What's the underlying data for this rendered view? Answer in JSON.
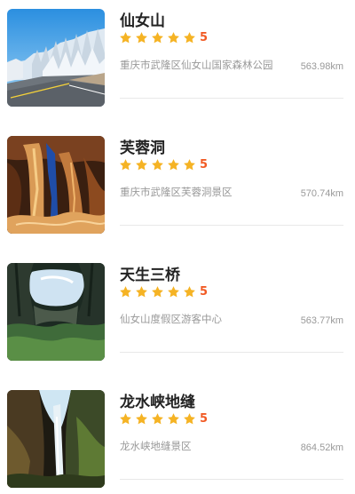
{
  "attractions": [
    {
      "name": "仙女山",
      "rating": 5,
      "rating_text": "5",
      "address": "重庆市武隆区仙女山国家森林公园",
      "distance": "563.98km",
      "thumbnail": "snowy-forest-road"
    },
    {
      "name": "芙蓉洞",
      "rating": 5,
      "rating_text": "5",
      "address": "重庆市武隆区芙蓉洞景区",
      "distance": "570.74km",
      "thumbnail": "karst-cave"
    },
    {
      "name": "天生三桥",
      "rating": 5,
      "rating_text": "5",
      "address": "仙女山度假区游客中心",
      "distance": "563.77km",
      "thumbnail": "natural-stone-bridge"
    },
    {
      "name": "龙水峡地缝",
      "rating": 5,
      "rating_text": "5",
      "address": "龙水峡地缝景区",
      "distance": "864.52km",
      "thumbnail": "gorge-waterfall"
    }
  ],
  "colors": {
    "star": "#f5b324",
    "score": "#f15a24",
    "title": "#222222",
    "meta": "#999999"
  }
}
